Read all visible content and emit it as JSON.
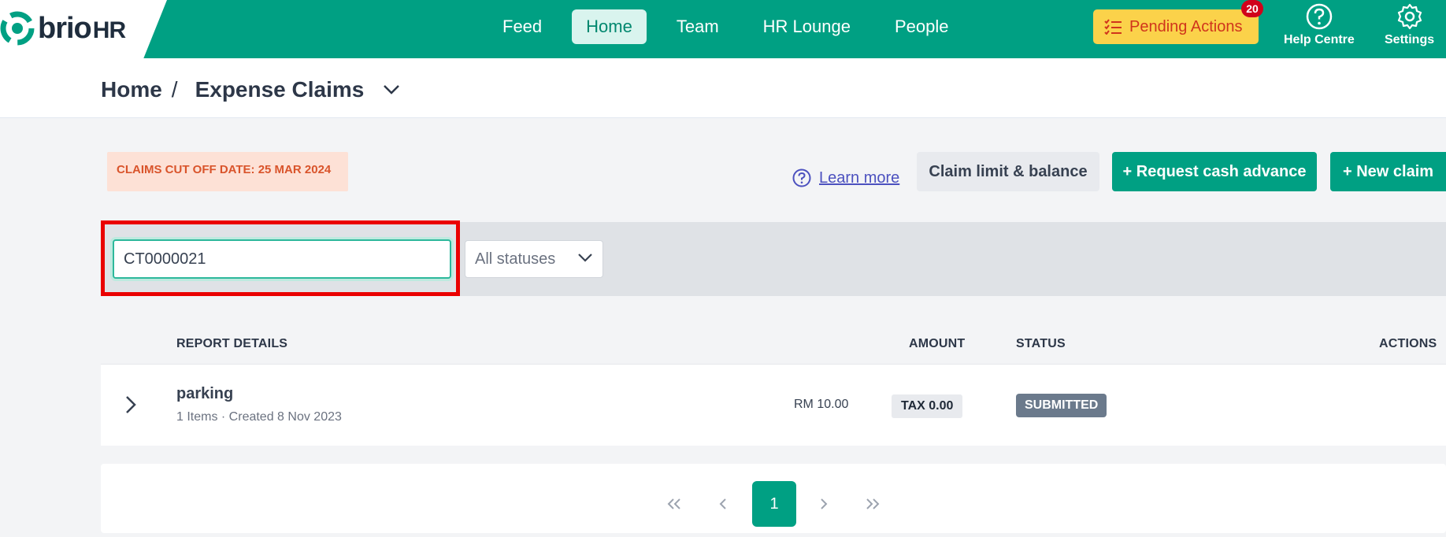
{
  "brand": {
    "name": "brio",
    "suffix": "HR"
  },
  "nav": {
    "items": [
      "Feed",
      "Home",
      "Team",
      "HR Lounge",
      "People"
    ],
    "active": "Home"
  },
  "pending": {
    "label": "Pending Actions",
    "count": "20"
  },
  "utilities": {
    "help": "Help Centre",
    "settings": "Settings"
  },
  "breadcrumb": {
    "root": "Home",
    "separator": "/",
    "current": "Expense Claims"
  },
  "cutoff": {
    "text": "CLAIMS CUT OFF DATE: 25 MAR 2024"
  },
  "actions": {
    "learn_more": "Learn more",
    "claim_limit": "Claim limit & balance",
    "cash_advance": "+ Request cash advance",
    "new_claim": "+ New claim"
  },
  "filters": {
    "search_value": "CT0000021",
    "status_selected": "All statuses"
  },
  "table": {
    "headers": {
      "details": "REPORT DETAILS",
      "amount": "AMOUNT",
      "status": "STATUS",
      "actions": "ACTIONS"
    },
    "rows": [
      {
        "title": "parking",
        "subtitle": "1 Items · Created 8 Nov 2023",
        "amount": "RM 10.00",
        "tax": "TAX 0.00",
        "status": "SUBMITTED"
      }
    ]
  },
  "pagination": {
    "first": "«",
    "prev": "‹",
    "current": "1",
    "next": "›",
    "last": "»"
  },
  "colors": {
    "brand": "#00a083",
    "pending_bg": "#fbd24a",
    "pending_text": "#d0351c",
    "cutoff_bg": "#fde1d6",
    "cutoff_text": "#d9542b",
    "status_submitted": "#6b7a8c",
    "highlight": "#ea0000"
  }
}
